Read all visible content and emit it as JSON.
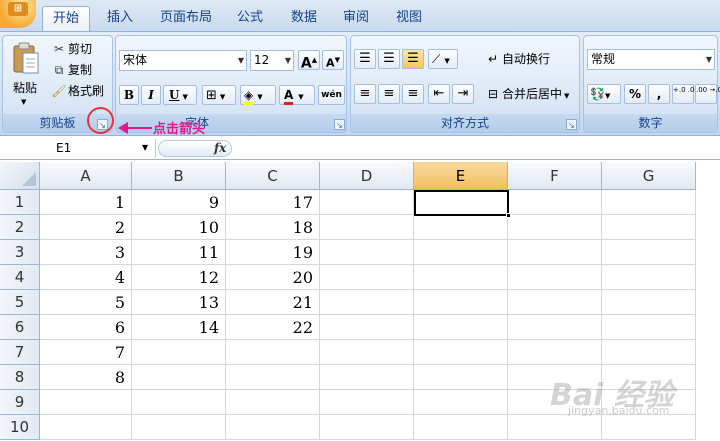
{
  "tabs": [
    {
      "label": "开始",
      "active": true
    },
    {
      "label": "插入",
      "active": false
    },
    {
      "label": "页面布局",
      "active": false
    },
    {
      "label": "公式",
      "active": false
    },
    {
      "label": "数据",
      "active": false
    },
    {
      "label": "审阅",
      "active": false
    },
    {
      "label": "视图",
      "active": false
    }
  ],
  "ribbon": {
    "clipboard": {
      "title": "剪贴板",
      "paste": "粘贴",
      "cut": "剪切",
      "copy": "复制",
      "format_painter": "格式刷"
    },
    "font": {
      "title": "字体",
      "font_name": "宋体",
      "font_size": "12",
      "bold": "B",
      "italic": "I",
      "underline": "U",
      "grow": "A",
      "shrink": "A",
      "phonetic": "wén"
    },
    "alignment": {
      "title": "对齐方式",
      "wrap_text": "自动换行",
      "merge_center": "合并后居中"
    },
    "number": {
      "title": "数字",
      "format": "常规",
      "percent": "%",
      "comma": ",",
      "inc_decimal": "+.0 .00",
      "dec_decimal": ".00 →.0"
    }
  },
  "formula_bar": {
    "name_box": "E1",
    "fx": "fx",
    "formula": ""
  },
  "columns": [
    "A",
    "B",
    "C",
    "D",
    "E",
    "F",
    "G"
  ],
  "selected_column": "E",
  "rows": [
    {
      "num": "1",
      "cells": [
        "1",
        "9",
        "17",
        "",
        "",
        "",
        ""
      ]
    },
    {
      "num": "2",
      "cells": [
        "2",
        "10",
        "18",
        "",
        "",
        "",
        ""
      ]
    },
    {
      "num": "3",
      "cells": [
        "3",
        "11",
        "19",
        "",
        "",
        "",
        ""
      ]
    },
    {
      "num": "4",
      "cells": [
        "4",
        "12",
        "20",
        "",
        "",
        "",
        ""
      ]
    },
    {
      "num": "5",
      "cells": [
        "5",
        "13",
        "21",
        "",
        "",
        "",
        ""
      ]
    },
    {
      "num": "6",
      "cells": [
        "6",
        "14",
        "22",
        "",
        "",
        "",
        ""
      ]
    },
    {
      "num": "7",
      "cells": [
        "7",
        "",
        "",
        "",
        "",
        "",
        ""
      ]
    },
    {
      "num": "8",
      "cells": [
        "8",
        "",
        "",
        "",
        "",
        "",
        ""
      ]
    },
    {
      "num": "9",
      "cells": [
        "",
        "",
        "",
        "",
        "",
        "",
        ""
      ]
    },
    {
      "num": "10",
      "cells": [
        "",
        "",
        "",
        "",
        "",
        "",
        ""
      ]
    }
  ],
  "annotation": {
    "text": "点击箭头",
    "color": "#e01a8c"
  },
  "watermark": {
    "text": "Bai 经验",
    "sub": "jingyan.baidu.com"
  },
  "colors": {
    "tab_text": "#15428b",
    "selected_header": "#f1c15f",
    "font_color_red": "#e02020",
    "fill_yellow": "#ffff00"
  }
}
